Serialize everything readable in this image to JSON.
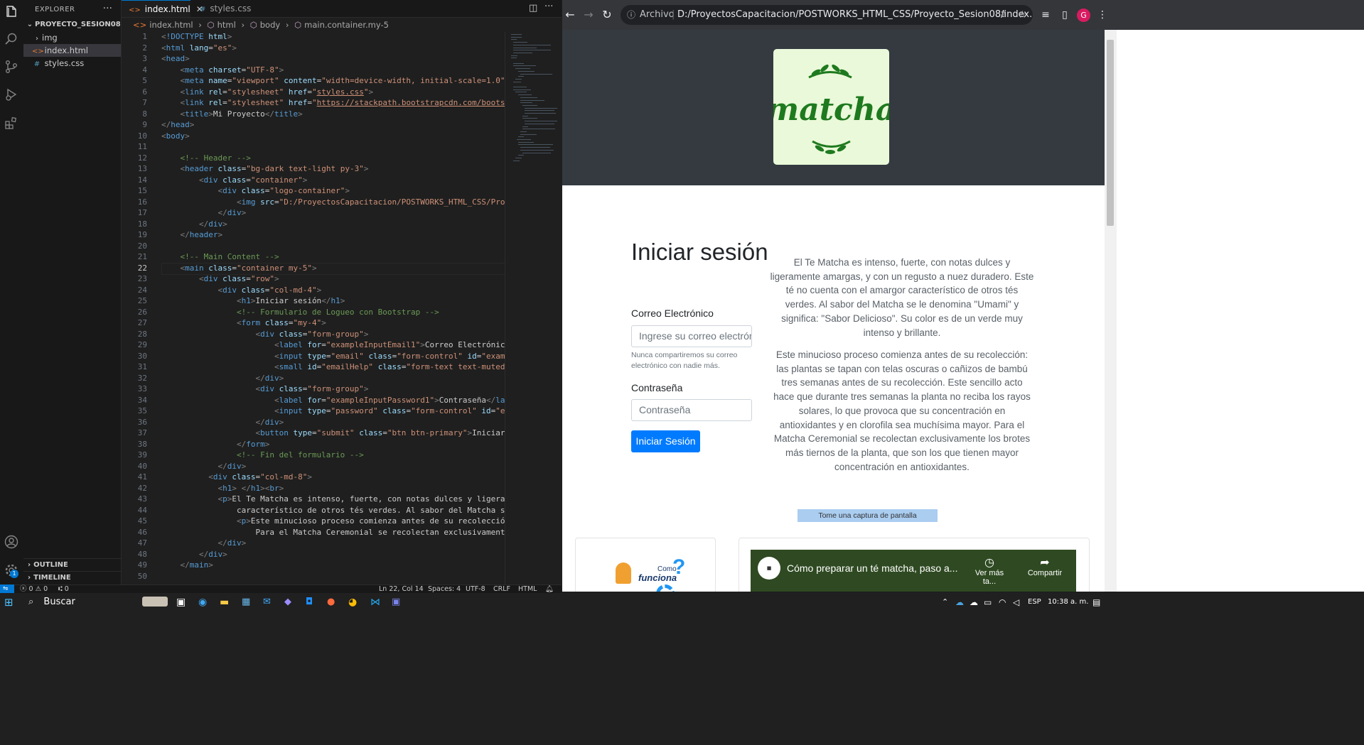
{
  "vscode": {
    "explorer": {
      "title": "EXPLORER",
      "project": "PROYECTO_SESION08",
      "items": [
        {
          "label": "img",
          "type": "folder"
        },
        {
          "label": "index.html",
          "type": "html",
          "selected": true
        },
        {
          "label": "styles.css",
          "type": "css"
        }
      ],
      "outline_label": "OUTLINE",
      "timeline_label": "TIMELINE"
    },
    "tabs": [
      {
        "label": "index.html",
        "active": true
      },
      {
        "label": "styles.css",
        "active": false
      }
    ],
    "breadcrumb": [
      "index.html",
      "html",
      "body",
      "main.container.my-5"
    ],
    "current_line": 22,
    "code": [
      {
        "n": 1,
        "html": "<span style='color:#808080'>&lt;</span><span style='color:#569cd6'>!DOCTYPE</span> <span style='color:#9cdcfe'>html</span><span style='color:#808080'>&gt;</span>"
      },
      {
        "n": 2,
        "html": "<span style='color:#808080'>&lt;</span><span style='color:#569cd6'>html</span> <span style='color:#9cdcfe'>lang</span>=<span style='color:#ce9178'>\"es\"</span><span style='color:#808080'>&gt;</span>"
      },
      {
        "n": 3,
        "html": "<span style='color:#808080'>&lt;</span><span style='color:#569cd6'>head</span><span style='color:#808080'>&gt;</span>"
      },
      {
        "n": 4,
        "html": "    <span style='color:#808080'>&lt;</span><span style='color:#569cd6'>meta</span> <span style='color:#9cdcfe'>charset</span>=<span style='color:#ce9178'>\"UTF-8\"</span><span style='color:#808080'>&gt;</span>"
      },
      {
        "n": 5,
        "html": "    <span style='color:#808080'>&lt;</span><span style='color:#569cd6'>meta</span> <span style='color:#9cdcfe'>name</span>=<span style='color:#ce9178'>\"viewport\"</span> <span style='color:#9cdcfe'>content</span>=<span style='color:#ce9178'>\"width=device-width, initial-scale=1.0\"</span><span style='color:#808080'>&gt;</span>"
      },
      {
        "n": 6,
        "html": "    <span style='color:#808080'>&lt;</span><span style='color:#569cd6'>link</span> <span style='color:#9cdcfe'>rel</span>=<span style='color:#ce9178'>\"stylesheet\"</span> <span style='color:#9cdcfe'>href</span>=<span style='color:#ce9178'>\"<u>styles.css</u>\"</span><span style='color:#808080'>&gt;</span>"
      },
      {
        "n": 7,
        "html": "    <span style='color:#808080'>&lt;</span><span style='color:#569cd6'>link</span> <span style='color:#9cdcfe'>rel</span>=<span style='color:#ce9178'>\"stylesheet\"</span> <span style='color:#9cdcfe'>href</span>=<span style='color:#ce9178'>\"<u>https://stackpath.bootstrapcdn.com/bootstrap</u></span>"
      },
      {
        "n": 8,
        "html": "    <span style='color:#808080'>&lt;</span><span style='color:#569cd6'>title</span><span style='color:#808080'>&gt;</span>Mi Proyecto<span style='color:#808080'>&lt;/</span><span style='color:#569cd6'>title</span><span style='color:#808080'>&gt;</span>"
      },
      {
        "n": 9,
        "html": "<span style='color:#808080'>&lt;/</span><span style='color:#569cd6'>head</span><span style='color:#808080'>&gt;</span>"
      },
      {
        "n": 10,
        "html": "<span style='color:#808080'>&lt;</span><span style='color:#569cd6'>body</span><span style='color:#808080'>&gt;</span>"
      },
      {
        "n": 11,
        "html": ""
      },
      {
        "n": 12,
        "html": "    <span style='color:#6a9955'>&lt;!-- Header --&gt;</span>"
      },
      {
        "n": 13,
        "html": "    <span style='color:#808080'>&lt;</span><span style='color:#569cd6'>header</span> <span style='color:#9cdcfe'>class</span>=<span style='color:#ce9178'>\"bg-dark text-light py-3\"</span><span style='color:#808080'>&gt;</span>"
      },
      {
        "n": 14,
        "html": "        <span style='color:#808080'>&lt;</span><span style='color:#569cd6'>div</span> <span style='color:#9cdcfe'>class</span>=<span style='color:#ce9178'>\"container\"</span><span style='color:#808080'>&gt;</span>"
      },
      {
        "n": 15,
        "html": "            <span style='color:#808080'>&lt;</span><span style='color:#569cd6'>div</span> <span style='color:#9cdcfe'>class</span>=<span style='color:#ce9178'>\"logo-container\"</span><span style='color:#808080'>&gt;</span>"
      },
      {
        "n": 16,
        "html": "                <span style='color:#808080'>&lt;</span><span style='color:#569cd6'>img</span> <span style='color:#9cdcfe'>src</span>=<span style='color:#ce9178'>\"D:/ProyectosCapacitacion/POSTWORKS_HTML_CSS/Proyect</span>"
      },
      {
        "n": 17,
        "html": "            <span style='color:#808080'>&lt;/</span><span style='color:#569cd6'>div</span><span style='color:#808080'>&gt;</span>"
      },
      {
        "n": 18,
        "html": "        <span style='color:#808080'>&lt;/</span><span style='color:#569cd6'>div</span><span style='color:#808080'>&gt;</span>"
      },
      {
        "n": 19,
        "html": "    <span style='color:#808080'>&lt;/</span><span style='color:#569cd6'>header</span><span style='color:#808080'>&gt;</span>"
      },
      {
        "n": 20,
        "html": ""
      },
      {
        "n": 21,
        "html": "    <span style='color:#6a9955'>&lt;!-- Main Content --&gt;</span>"
      },
      {
        "n": 22,
        "html": "    <span style='color:#808080'>&lt;</span><span style='color:#569cd6'>main</span> <span style='color:#9cdcfe'>class</span>=<span style='color:#ce9178'>\"container my-5\"</span><span style='color:#808080'>&gt;</span>"
      },
      {
        "n": 23,
        "html": "        <span style='color:#808080'>&lt;</span><span style='color:#569cd6'>div</span> <span style='color:#9cdcfe'>class</span>=<span style='color:#ce9178'>\"row\"</span><span style='color:#808080'>&gt;</span>"
      },
      {
        "n": 24,
        "html": "            <span style='color:#808080'>&lt;</span><span style='color:#569cd6'>div</span> <span style='color:#9cdcfe'>class</span>=<span style='color:#ce9178'>\"col-md-4\"</span><span style='color:#808080'>&gt;</span>"
      },
      {
        "n": 25,
        "html": "                <span style='color:#808080'>&lt;</span><span style='color:#569cd6'>h1</span><span style='color:#808080'>&gt;</span>Iniciar sesión<span style='color:#808080'>&lt;/</span><span style='color:#569cd6'>h1</span><span style='color:#808080'>&gt;</span>"
      },
      {
        "n": 26,
        "html": "                <span style='color:#6a9955'>&lt;!-- Formulario de Logueo con Bootstrap --&gt;</span>"
      },
      {
        "n": 27,
        "html": "                <span style='color:#808080'>&lt;</span><span style='color:#569cd6'>form</span> <span style='color:#9cdcfe'>class</span>=<span style='color:#ce9178'>\"my-4\"</span><span style='color:#808080'>&gt;</span>"
      },
      {
        "n": 28,
        "html": "                    <span style='color:#808080'>&lt;</span><span style='color:#569cd6'>div</span> <span style='color:#9cdcfe'>class</span>=<span style='color:#ce9178'>\"form-group\"</span><span style='color:#808080'>&gt;</span>"
      },
      {
        "n": 29,
        "html": "                        <span style='color:#808080'>&lt;</span><span style='color:#569cd6'>label</span> <span style='color:#9cdcfe'>for</span>=<span style='color:#ce9178'>\"exampleInputEmail1\"</span><span style='color:#808080'>&gt;</span>Correo Electrónico<span style='color:#808080'>&lt;/</span><span style='color:#569cd6'>label</span>"
      },
      {
        "n": 30,
        "html": "                        <span style='color:#808080'>&lt;</span><span style='color:#569cd6'>input</span> <span style='color:#9cdcfe'>type</span>=<span style='color:#ce9178'>\"email\"</span> <span style='color:#9cdcfe'>class</span>=<span style='color:#ce9178'>\"form-control\"</span> <span style='color:#9cdcfe'>id</span>=<span style='color:#ce9178'>\"exampleInput</span>"
      },
      {
        "n": 31,
        "html": "                        <span style='color:#808080'>&lt;</span><span style='color:#569cd6'>small</span> <span style='color:#9cdcfe'>id</span>=<span style='color:#ce9178'>\"emailHelp\"</span> <span style='color:#9cdcfe'>class</span>=<span style='color:#ce9178'>\"form-text text-muted\"</span><span style='color:#808080'>&gt;</span>Nunca"
      },
      {
        "n": 32,
        "html": "                    <span style='color:#808080'>&lt;/</span><span style='color:#569cd6'>div</span><span style='color:#808080'>&gt;</span>"
      },
      {
        "n": 33,
        "html": "                    <span style='color:#808080'>&lt;</span><span style='color:#569cd6'>div</span> <span style='color:#9cdcfe'>class</span>=<span style='color:#ce9178'>\"form-group\"</span><span style='color:#808080'>&gt;</span>"
      },
      {
        "n": 34,
        "html": "                        <span style='color:#808080'>&lt;</span><span style='color:#569cd6'>label</span> <span style='color:#9cdcfe'>for</span>=<span style='color:#ce9178'>\"exampleInputPassword1\"</span><span style='color:#808080'>&gt;</span>Contraseña<span style='color:#808080'>&lt;/</span><span style='color:#569cd6'>label</span><span style='color:#808080'>&gt;</span>"
      },
      {
        "n": 35,
        "html": "                        <span style='color:#808080'>&lt;</span><span style='color:#569cd6'>input</span> <span style='color:#9cdcfe'>type</span>=<span style='color:#ce9178'>\"password\"</span> <span style='color:#9cdcfe'>class</span>=<span style='color:#ce9178'>\"form-control\"</span> <span style='color:#9cdcfe'>id</span>=<span style='color:#ce9178'>\"exampleIn</span>"
      },
      {
        "n": 36,
        "html": "                    <span style='color:#808080'>&lt;/</span><span style='color:#569cd6'>div</span><span style='color:#808080'>&gt;</span>"
      },
      {
        "n": 37,
        "html": "                    <span style='color:#808080'>&lt;</span><span style='color:#569cd6'>button</span> <span style='color:#9cdcfe'>type</span>=<span style='color:#ce9178'>\"submit\"</span> <span style='color:#9cdcfe'>class</span>=<span style='color:#ce9178'>\"btn btn-primary\"</span><span style='color:#808080'>&gt;</span>Iniciar Sesió"
      },
      {
        "n": 38,
        "html": "                <span style='color:#808080'>&lt;/</span><span style='color:#569cd6'>form</span><span style='color:#808080'>&gt;</span>"
      },
      {
        "n": 39,
        "html": "                <span style='color:#6a9955'>&lt;!-- Fin del formulario --&gt;</span>"
      },
      {
        "n": 40,
        "html": "            <span style='color:#808080'>&lt;/</span><span style='color:#569cd6'>div</span><span style='color:#808080'>&gt;</span>"
      },
      {
        "n": 41,
        "html": "          <span style='color:#808080'>&lt;</span><span style='color:#569cd6'>div</span> <span style='color:#9cdcfe'>class</span>=<span style='color:#ce9178'>\"col-md-8\"</span><span style='color:#808080'>&gt;</span>"
      },
      {
        "n": 42,
        "html": "            <span style='color:#808080'>&lt;</span><span style='color:#569cd6'>h1</span><span style='color:#808080'>&gt;</span> <span style='color:#808080'>&lt;/</span><span style='color:#569cd6'>h1</span><span style='color:#808080'>&gt;&lt;</span><span style='color:#569cd6'>br</span><span style='color:#808080'>&gt;</span>"
      },
      {
        "n": 43,
        "html": "            <span style='color:#808080'>&lt;</span><span style='color:#569cd6'>p</span><span style='color:#808080'>&gt;</span>El Te Matcha es intenso, fuerte, con notas dulces y ligerament"
      },
      {
        "n": 44,
        "html": "                característico de otros tés verdes. Al sabor del Matcha se le"
      },
      {
        "n": 45,
        "html": "                <span style='color:#808080'>&lt;</span><span style='color:#569cd6'>p</span><span style='color:#808080'>&gt;</span>Este minucioso proceso comienza antes de su recolección: l"
      },
      {
        "n": 46,
        "html": "                    Para el Matcha Ceremonial se recolectan exclusivamente lo"
      },
      {
        "n": 47,
        "html": "            <span style='color:#808080'>&lt;/</span><span style='color:#569cd6'>div</span><span style='color:#808080'>&gt;</span>"
      },
      {
        "n": 48,
        "html": "        <span style='color:#808080'>&lt;/</span><span style='color:#569cd6'>div</span><span style='color:#808080'>&gt;</span>"
      },
      {
        "n": 49,
        "html": "    <span style='color:#808080'>&lt;/</span><span style='color:#569cd6'>main</span><span style='color:#808080'>&gt;</span>"
      },
      {
        "n": 50,
        "html": ""
      }
    ],
    "status": {
      "errors": "0",
      "warnings": "0",
      "ports": "0",
      "position": "Ln 22, Col 14",
      "spaces": "Spaces: 4",
      "encoding": "UTF-8",
      "eol": "CRLF",
      "language": "HTML"
    },
    "accounts_badge": "1"
  },
  "browser": {
    "scheme_label": "Archivo",
    "url": "D:/ProyectosCapacitacion/POSTWORKS_HTML_CSS/Proyecto_Sesion08/index.html?",
    "profile_initial": "G"
  },
  "site": {
    "logo_text": "matcha",
    "login_title": "Iniciar sesión",
    "email_label": "Correo Electrónico",
    "email_placeholder": "Ingrese su correo electrón",
    "email_help": "Nunca compartiremos su correo electrónico con nadie más.",
    "password_label": "Contraseña",
    "password_placeholder": "Contraseña",
    "login_button": "Iniciar Sesión",
    "paragraph1": "El Te Matcha es intenso, fuerte, con notas dulces y ligeramente amargas, y con un regusto a nuez duradero. Este té no cuenta con el amargor característico de otros tés verdes. Al sabor del Matcha se le denomina \"Umami\" y significa: \"Sabor Delicioso\". Su color es de un verde muy intenso y brillante.",
    "paragraph2": "Este minucioso proceso comienza antes de su recolección: las plantas se tapan con telas oscuras o cañizos de bambú tres semanas antes de su recolección. Este sencillo acto hace que durante tres semanas la planta no reciba los rayos solares, lo que provoca que su concentración en antioxidantes y en clorofila sea muchísima mayor. Para el Matcha Ceremonial se recolectan exclusivamente los brotes más tiernos de la planta, que son los que tienen mayor concentración en antioxidantes.",
    "capture_button": "Tome una captura de pantalla",
    "card_title_small": "Como",
    "card_title_big": "funciona",
    "video_title": "Cómo preparar un té matcha, paso a...",
    "video_watch_later": "Ver más ta...",
    "video_share": "Compartir"
  },
  "taskbar": {
    "search_placeholder": "Buscar",
    "language": "ESP",
    "time": "10:38 a. m."
  }
}
